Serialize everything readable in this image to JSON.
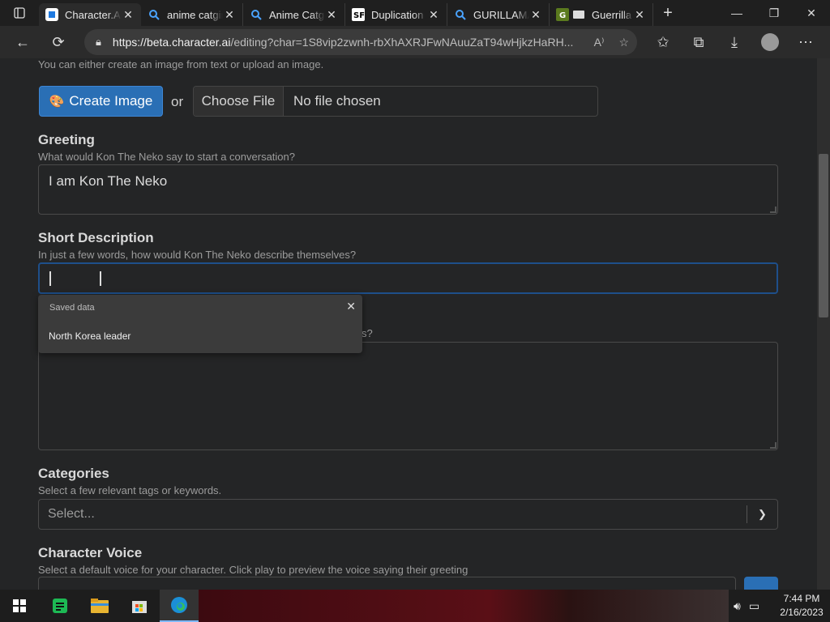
{
  "browser": {
    "tabs": [
      {
        "title": "Character.AI",
        "favicon": "character-ai-icon",
        "active": true
      },
      {
        "title": "anime catgirl",
        "favicon": "search-icon",
        "active": false
      },
      {
        "title": "Anime Catgirl",
        "favicon": "search-icon",
        "active": false
      },
      {
        "title": "Duplication",
        "favicon": "duplication-site-icon",
        "active": false
      },
      {
        "title": "GURILLAMAN",
        "favicon": "search-icon",
        "active": false
      },
      {
        "title": "Guerrilla",
        "favicon": "g-site-icon",
        "active": false
      }
    ],
    "url_host": "https://beta.character.ai",
    "url_path": "/editing?char=1S8vip2zwnh-rbXhAXRJFwNAuuZaT94wHjkzHaRH..."
  },
  "form": {
    "image_helper": "You can either create an image from text or upload an image.",
    "create_image_label": "Create Image",
    "create_image_emoji": "🎨",
    "or_label": "or",
    "choose_file_label": "Choose File",
    "no_file_label": "No file chosen",
    "greeting_label": "Greeting",
    "greeting_helper": "What would Kon The Neko say to start a conversation?",
    "greeting_value": "I am Kon The Neko",
    "short_desc_label": "Short Description",
    "short_desc_helper": "In just a few words, how would Kon The Neko describe themselves?",
    "short_desc_value": "",
    "long_desc_helper_tail": "s?",
    "categories_label": "Categories",
    "categories_helper": "Select a few relevant tags or keywords.",
    "categories_placeholder": "Select...",
    "voice_label": "Character Voice",
    "voice_helper": "Select a default voice for your character. Click play to preview the voice saying their greeting"
  },
  "autocomplete": {
    "header": "Saved data",
    "items": [
      "North Korea leader"
    ]
  },
  "taskbar": {
    "time": "7:44 PM",
    "date": "2/16/2023"
  },
  "colors": {
    "accent": "#2a6fb5",
    "background": "#242526",
    "focus_border": "#1e4f8a"
  }
}
